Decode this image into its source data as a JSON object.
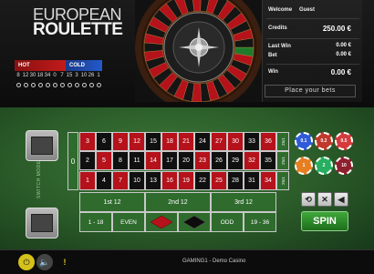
{
  "logo": {
    "line1": "EUROPEAN",
    "line2": "ROULETTE"
  },
  "hotcold": {
    "hot_label": "HOT",
    "cold_label": "COLD",
    "numbers": [
      "8",
      "12",
      "30",
      "18",
      "34",
      "0",
      "7",
      "15",
      "3",
      "10",
      "26",
      "1"
    ]
  },
  "info": {
    "welcome_label": "Welcome",
    "user": "Guest",
    "credits_label": "Credits",
    "credits": "250.00 €",
    "last_win_label": "Last Win",
    "last_win": "0.00 €",
    "bet_label": "Bet",
    "bet": "0.00 €",
    "win_label": "Win",
    "win": "0.00 €",
    "place_bets": "Place your bets"
  },
  "board": {
    "zero": "0",
    "row_top": [
      "3",
      "6",
      "9",
      "12",
      "15",
      "18",
      "21",
      "24",
      "27",
      "30",
      "33",
      "36"
    ],
    "row_mid": [
      "2",
      "5",
      "8",
      "11",
      "14",
      "17",
      "20",
      "23",
      "26",
      "29",
      "32",
      "35"
    ],
    "row_bot": [
      "1",
      "4",
      "7",
      "10",
      "13",
      "16",
      "19",
      "22",
      "25",
      "28",
      "31",
      "34"
    ],
    "two_to_one": "2to1",
    "dozens": [
      "1st 12",
      "2nd 12",
      "3rd 12"
    ],
    "outside": [
      "1 - 18",
      "EVEN",
      "",
      "",
      "ODD",
      "19 - 36"
    ],
    "side_label": "SWITCH MODE"
  },
  "chips": [
    "0.1",
    "0.2",
    "0.5",
    "1",
    "2",
    "10"
  ],
  "controls": {
    "spin": "SPIN"
  },
  "footer": {
    "text": "GAMING1 - Demo Casino"
  },
  "colors": {
    "red": "#b5121b",
    "black": "#101010",
    "felt": "#2f6b2d"
  }
}
